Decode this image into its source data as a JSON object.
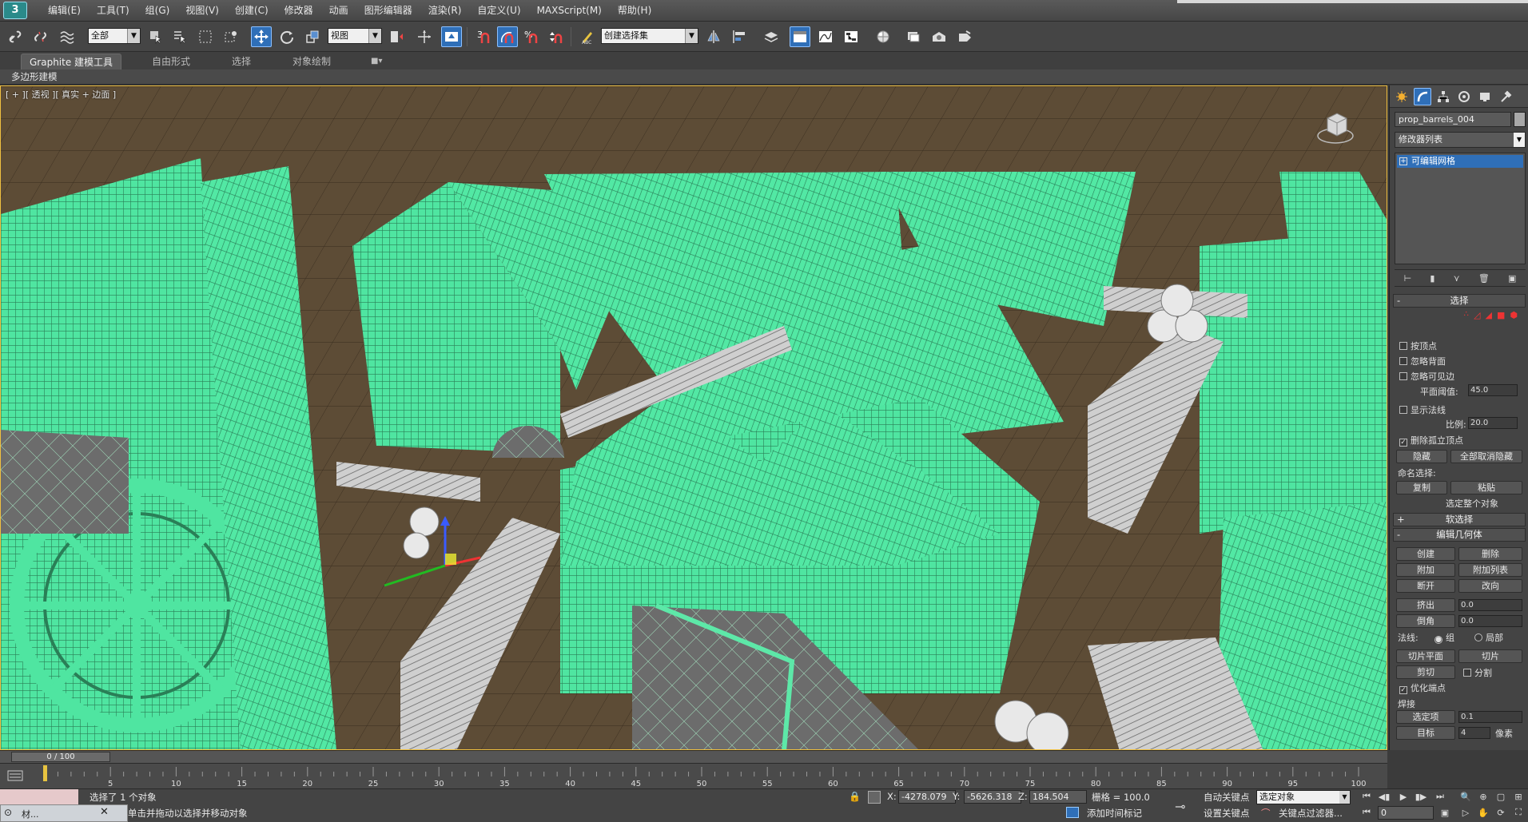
{
  "menu": {
    "logo": "3",
    "items": [
      "编辑(E)",
      "工具(T)",
      "组(G)",
      "视图(V)",
      "创建(C)",
      "修改器",
      "动画",
      "图形编辑器",
      "渲染(R)",
      "自定义(U)",
      "MAXScript(M)",
      "帮助(H)"
    ]
  },
  "toolbar": {
    "selection_filter": "全部",
    "ref_coord": "视图",
    "named_selection_set": "创建选择集",
    "snap_label": "3",
    "percent_label": "%"
  },
  "ribbon": {
    "tabs": [
      "Graphite 建模工具",
      "自由形式",
      "选择",
      "对象绘制"
    ],
    "sub_label": "多边形建模"
  },
  "viewport": {
    "label": "[ + ][ 透视 ][ 真实 + 边面 ]"
  },
  "command_panel": {
    "object_name": "prop_barrels_004",
    "modifier_list": "修改器列表",
    "stack_item": "可编辑网格",
    "selection": {
      "title": "选择",
      "by_vertex": "按顶点",
      "ignore_backfacing": "忽略背面",
      "ignore_visible_edges": "忽略可见边",
      "planar_threshold_label": "平面阈值:",
      "planar_threshold": "45.0",
      "show_normals": "显示法线",
      "scale_label": "比例:",
      "scale": "20.0",
      "delete_isolated": "删除孤立顶点",
      "hide": "隐藏",
      "unhide_all": "全部取消隐藏",
      "named_selections": "命名选择:",
      "copy": "复制",
      "paste": "粘贴",
      "whole_object": "选定整个对象"
    },
    "soft_selection": "软选择",
    "edit_geometry": {
      "title": "编辑几何体",
      "create": "创建",
      "delete": "删除",
      "attach": "附加",
      "attach_list": "附加列表",
      "detach": "断开",
      "turn": "改向",
      "extrude": "挤出",
      "extrude_val": "0.0",
      "chamfer": "倒角",
      "chamfer_val": "0.0",
      "normal_label": "法线:",
      "group": "组",
      "local": "局部",
      "slice_plane": "切片平面",
      "slice": "切片",
      "cut": "剪切",
      "split": "分割",
      "refine_ends": "优化端点",
      "weld": "焊接",
      "selected": "选定项",
      "selected_val": "0.1",
      "target": "目标",
      "target_val": "4",
      "pixels": "像素"
    }
  },
  "timeline": {
    "frame_display": "0 / 100",
    "ticks": [
      0,
      5,
      10,
      15,
      20,
      25,
      30,
      35,
      40,
      45,
      50,
      55,
      60,
      65,
      70,
      75,
      80,
      85,
      90,
      95,
      100
    ]
  },
  "status": {
    "selected_msg": "选择了 1 个对象",
    "prompt": "单击并拖动以选择并移动对象",
    "taskbar_label": "材...",
    "x_label": "X:",
    "x": "-4278.079",
    "y_label": "Y:",
    "y": "-5626.318",
    "z_label": "Z:",
    "z": "184.504",
    "grid": "栅格 = 100.0",
    "auto_key": "自动关键点",
    "set_key": "设置关键点",
    "key_mode": "选定对象",
    "add_time_tag": "添加时间标记",
    "key_filters": "关键点过滤器...",
    "current_frame": "0"
  },
  "colors": {
    "wire_green": "#4ee6a0",
    "selection_blue": "#2f6fb8",
    "ground": "#5d4c36"
  }
}
